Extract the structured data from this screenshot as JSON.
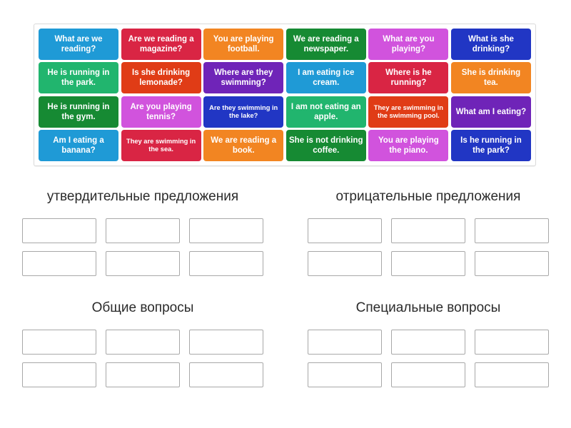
{
  "activity": {
    "type": "drag-and-drop-sorting",
    "tile_bank": {
      "name": "sentence-tile-bank",
      "rows": [
        [
          {
            "text": "What are we reading?",
            "color": "#1f9ad6",
            "small": false
          },
          {
            "text": "Are we reading a magazine?",
            "color": "#d92544",
            "small": false
          },
          {
            "text": "You are playing football.",
            "color": "#f28522",
            "small": false
          },
          {
            "text": "We are reading a newspaper.",
            "color": "#168a33",
            "small": false
          },
          {
            "text": "What are you playing?",
            "color": "#d153dd",
            "small": false
          },
          {
            "text": "What is she drinking?",
            "color": "#2136c4",
            "small": false
          }
        ],
        [
          {
            "text": "He is running in the park.",
            "color": "#21b56e",
            "small": false
          },
          {
            "text": "Is she drinking lemonade?",
            "color": "#e03c16",
            "small": false
          },
          {
            "text": "Where are they swimming?",
            "color": "#6f24b8",
            "small": false
          },
          {
            "text": "I am eating ice cream.",
            "color": "#1f9ad6",
            "small": false
          },
          {
            "text": "Where is he running?",
            "color": "#d92544",
            "small": false
          },
          {
            "text": "She is drinking tea.",
            "color": "#f28522",
            "small": false
          }
        ],
        [
          {
            "text": "He is running in the gym.",
            "color": "#168a33",
            "small": false
          },
          {
            "text": "Are you playing tennis?",
            "color": "#d153dd",
            "small": false
          },
          {
            "text": "Are they swimming in the lake?",
            "color": "#2136c4",
            "small": true
          },
          {
            "text": "I am not eating an apple.",
            "color": "#21b56e",
            "small": false
          },
          {
            "text": "They are swimming in the swimming pool.",
            "color": "#e03c16",
            "small": true
          },
          {
            "text": "What am I eating?",
            "color": "#6f24b8",
            "small": false
          }
        ],
        [
          {
            "text": "Am I eating a banana?",
            "color": "#1f9ad6",
            "small": false
          },
          {
            "text": "They are swimming in the sea.",
            "color": "#d92544",
            "small": true
          },
          {
            "text": "We are reading a book.",
            "color": "#f28522",
            "small": false
          },
          {
            "text": "She is not drinking coffee.",
            "color": "#168a33",
            "small": false
          },
          {
            "text": "You are playing the piano.",
            "color": "#d153dd",
            "small": false
          },
          {
            "text": "Is he running in the park?",
            "color": "#2136c4",
            "small": false
          }
        ]
      ]
    },
    "categories": [
      {
        "title": "утвердительные предложения",
        "slot_rows": 2,
        "slots_per_row": 3
      },
      {
        "title": "отрицательные предложения",
        "slot_rows": 2,
        "slots_per_row": 3
      },
      {
        "title": "Общие вопросы",
        "slot_rows": 2,
        "slots_per_row": 3
      },
      {
        "title": "Специальные вопросы",
        "slot_rows": 2,
        "slots_per_row": 3
      }
    ]
  }
}
